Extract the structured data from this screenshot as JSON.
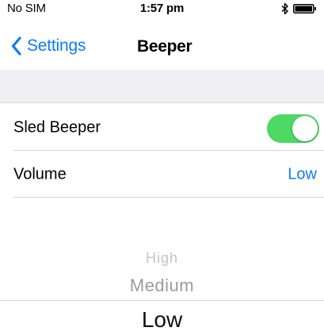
{
  "status_bar": {
    "carrier": "No SIM",
    "time": "1:57 pm",
    "icons": [
      "bluetooth-icon",
      "battery-icon"
    ]
  },
  "nav": {
    "back_label": "Settings",
    "title": "Beeper"
  },
  "rows": {
    "sled_beeper": {
      "label": "Sled Beeper",
      "toggle_on": true
    },
    "volume": {
      "label": "Volume",
      "value": "Low"
    }
  },
  "picker": {
    "options": [
      "High",
      "Medium",
      "Low"
    ],
    "selected": "Low"
  },
  "colors": {
    "accent": "#0f7bf4",
    "toggle_on": "#4cd964",
    "group_bg": "#efeff4"
  }
}
